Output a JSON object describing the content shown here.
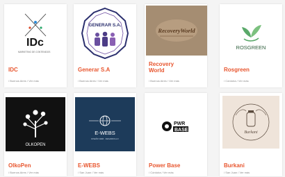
{
  "cards": [
    {
      "name": "IDC",
      "location": "/ Buenos Aires / Ver más",
      "logo_text": "IDc",
      "logo_caption": "MARKETING DE CONTENIDOS"
    },
    {
      "name": "Generar S.A",
      "location": "/ Buenos Aires / Ver más",
      "logo_text": "GENERAR S.A."
    },
    {
      "name": "Recovery World",
      "location": "/ Buenos Aires / Ver más",
      "logo_text": "RecoveryWorld"
    },
    {
      "name": "Rosgreen",
      "location": "/ Córdoba / Ver más",
      "logo_text": "ROSGREEN"
    },
    {
      "name": "OlkoPen",
      "location": "/ Buenos Aires / Ver más",
      "logo_text": "OLKOPEN"
    },
    {
      "name": "E-WEBS",
      "location": "/ San Juan / Ver más",
      "logo_text": "E-WEBS",
      "logo_caption": "DISEÑO WEB · DESARROLLO"
    },
    {
      "name": "Power Base",
      "location": "/ Córdoba / Ver más",
      "logo_text_1": "PWR",
      "logo_text_2": "BASE"
    },
    {
      "name": "Burkani",
      "location": "/ San Juan / Ver más",
      "logo_text": "Burkani"
    }
  ],
  "colors": {
    "accent": "#e8562f",
    "page_bg": "#f4f4f4",
    "ewebs_bg": "#1d3b5a",
    "olko_bg": "#111111"
  }
}
